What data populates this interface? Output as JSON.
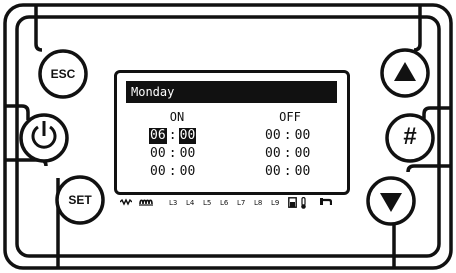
{
  "screen": {
    "day": "Monday",
    "col_on": "ON",
    "col_off": "OFF",
    "rows": [
      {
        "on_h": "06",
        "on_m": "00",
        "off_h": "00",
        "off_m": "00"
      },
      {
        "on_h": "00",
        "on_m": "00",
        "off_h": "00",
        "off_m": "00"
      },
      {
        "on_h": "00",
        "on_m": "00",
        "off_h": "00",
        "off_m": "00"
      }
    ],
    "separator": ":"
  },
  "buttons": {
    "esc": "ESC",
    "set": "SET",
    "hash": "#"
  },
  "status_bar": {
    "labels": [
      "L3",
      "L4",
      "L5",
      "L6",
      "L7",
      "L8",
      "L9"
    ],
    "icons": [
      "heater-coil-icon",
      "heating-element-icon",
      "tank-icon",
      "thermometer-icon",
      "faucet-icon"
    ]
  },
  "colors": {
    "ink": "#111111",
    "background": "#ffffff"
  }
}
